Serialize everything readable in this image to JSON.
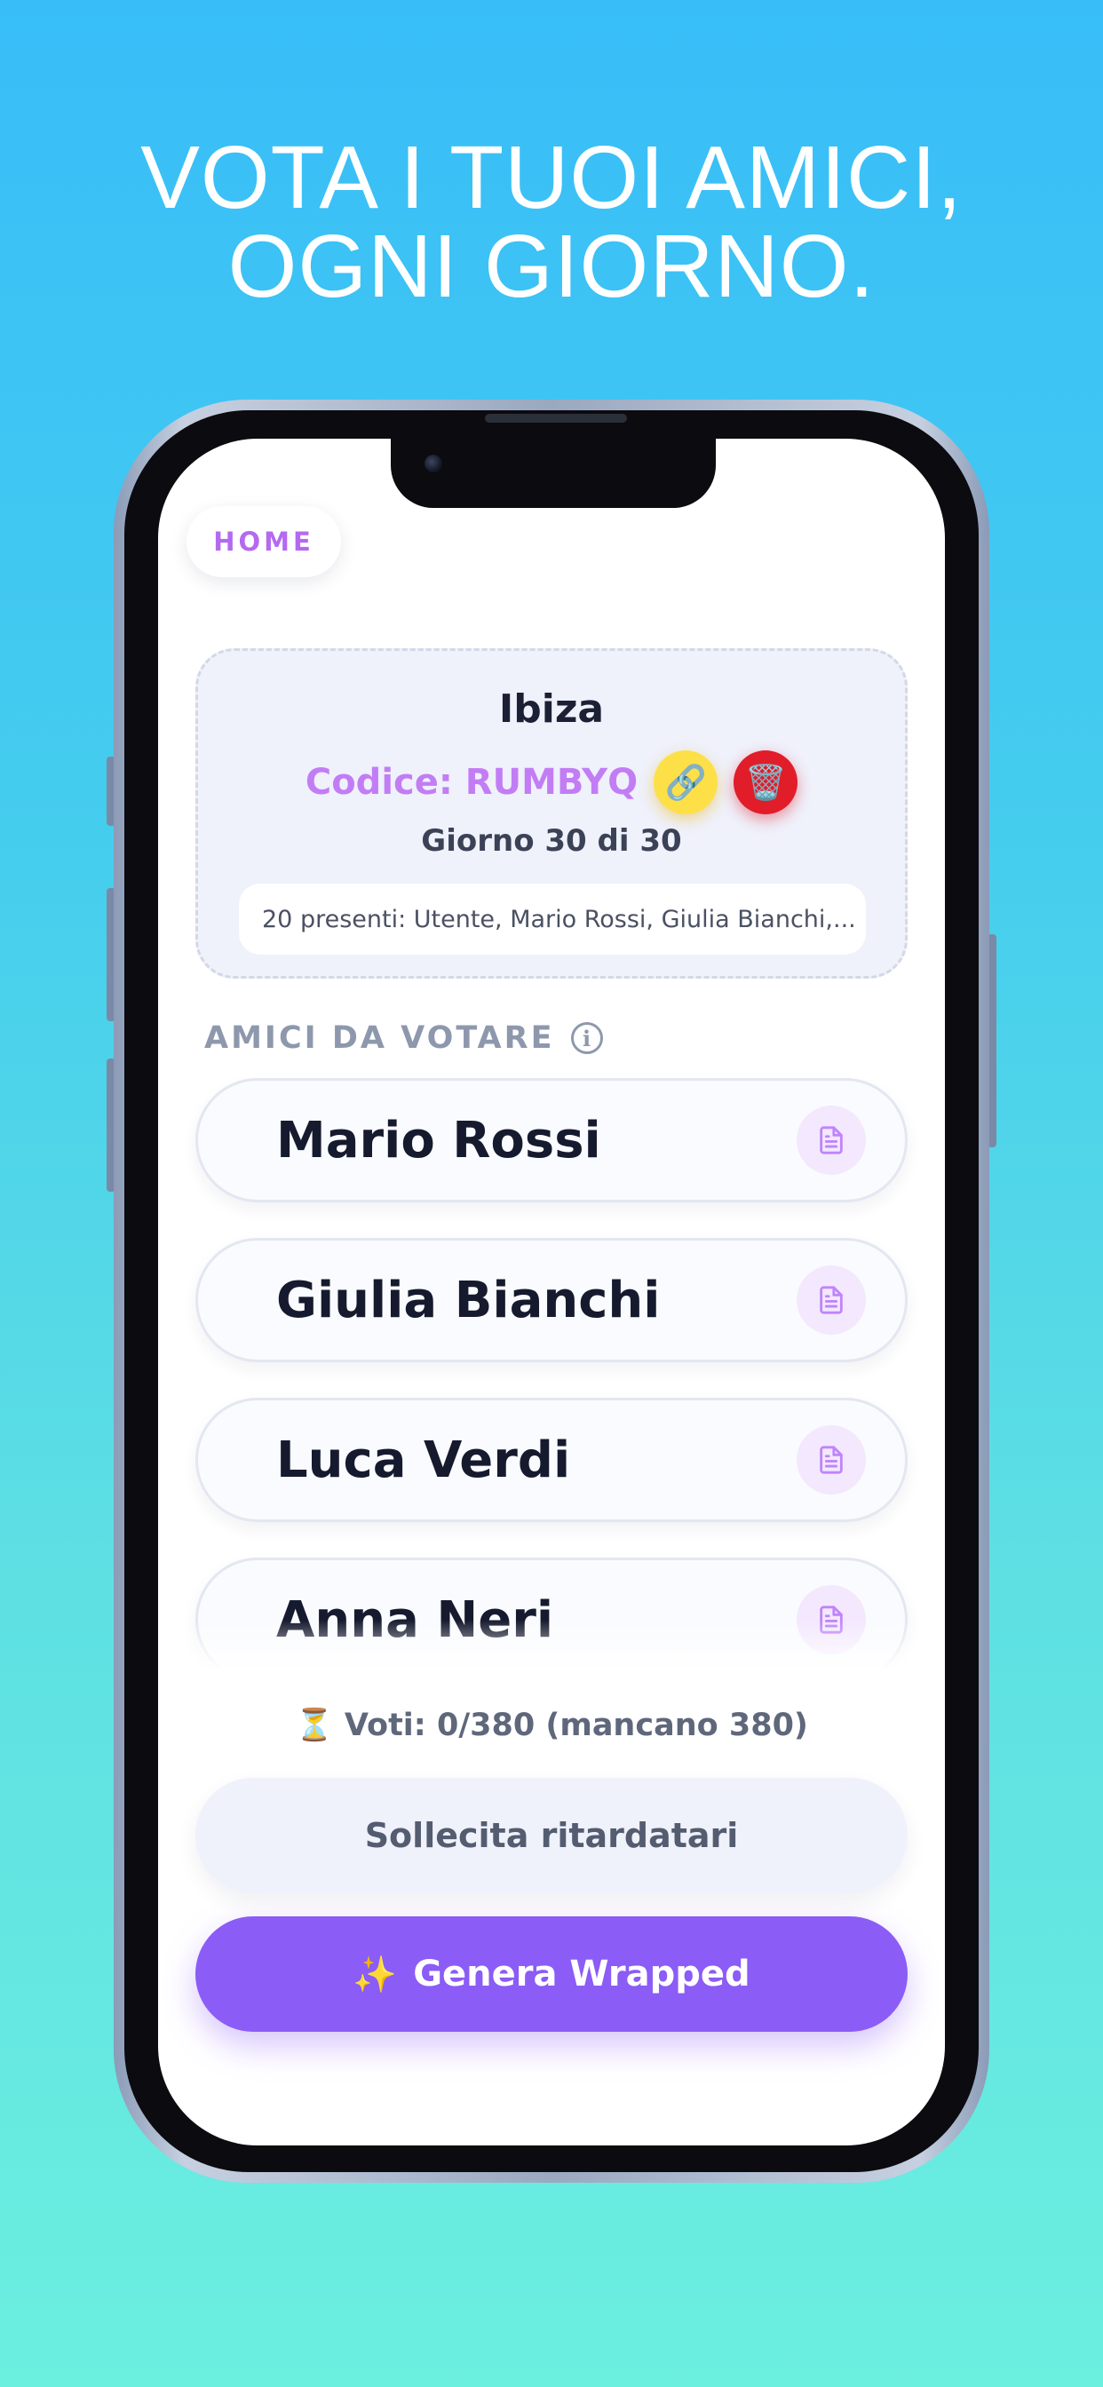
{
  "headline": {
    "line1": "VOTA I TUOI AMICI,",
    "line2": "OGNI GIORNO."
  },
  "nav": {
    "home_label": "HOME"
  },
  "group": {
    "name": "Ibiza",
    "code_label": "Codice: RUMBYQ",
    "link_icon": "🔗",
    "trash_icon": "🗑️",
    "day_label": "Giorno 30 di 30",
    "present_label": "20 presenti: Utente, Mario Rossi, Giulia Bianchi,..."
  },
  "friends_section": {
    "title": "AMICI DA VOTARE",
    "info_icon": "i",
    "friends": [
      {
        "name": "Mario Rossi"
      },
      {
        "name": "Giulia Bianchi"
      },
      {
        "name": "Luca Verdi"
      },
      {
        "name": "Anna Neri"
      }
    ]
  },
  "votes": {
    "icon": "⏳",
    "label": "Voti: 0/380 (mancano 380)"
  },
  "actions": {
    "remind_label": "Sollecita ritardatari",
    "wrapped_icon": "✨",
    "wrapped_label": "Genera Wrapped"
  },
  "colors": {
    "accent_purple": "#8b5cf6",
    "code_purple": "#c27df5",
    "link_yellow": "#fde047",
    "trash_red": "#e11d2a",
    "bg_top": "#38bdf8",
    "bg_bottom": "#6befdf"
  }
}
